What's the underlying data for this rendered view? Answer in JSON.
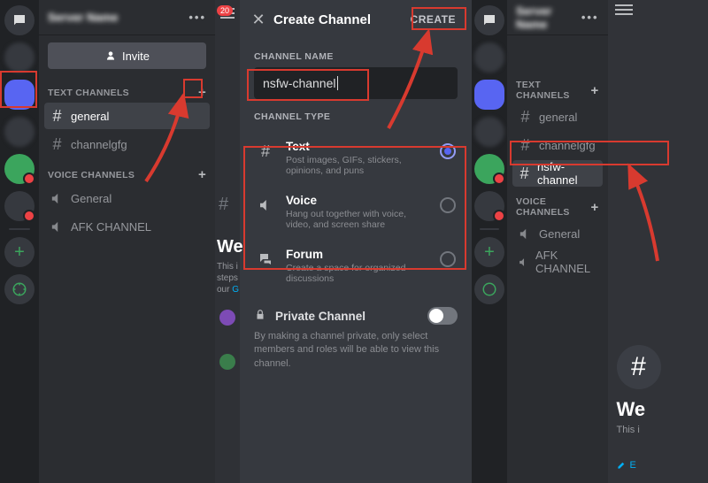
{
  "left": {
    "server_name_blur": "Server Name",
    "invite_label": "Invite",
    "cat_text": "TEXT CHANNELS",
    "cat_voice": "VOICE CHANNELS",
    "channels_text": [
      {
        "name": "general",
        "active": true
      },
      {
        "name": "channelgfg",
        "active": false
      }
    ],
    "channels_voice": [
      {
        "name": "General"
      },
      {
        "name": "AFK CHANNEL"
      }
    ]
  },
  "modal": {
    "title": "Create Channel",
    "create_label": "CREATE",
    "name_section": "CHANNEL NAME",
    "name_value": "nsfw-channel",
    "type_section": "CHANNEL TYPE",
    "types": [
      {
        "title": "Text",
        "desc": "Post images, GIFs, stickers, opinions, and puns",
        "selected": true
      },
      {
        "title": "Voice",
        "desc": "Hang out together with voice, video, and screen share",
        "selected": false
      },
      {
        "title": "Forum",
        "desc": "Create a space for organized discussions",
        "selected": false
      }
    ],
    "private_label": "Private Channel",
    "private_desc": "By making a channel private, only select members and roles will be able to view this channel.",
    "badge": "20"
  },
  "right": {
    "server_name_blur": "Server Name",
    "cat_text": "TEXT CHANNELS",
    "cat_voice": "VOICE CHANNELS",
    "channels_text": [
      {
        "name": "general",
        "active": false
      },
      {
        "name": "channelgfg",
        "active": false
      },
      {
        "name": "nsfw-channel",
        "active": true
      }
    ],
    "channels_voice": [
      {
        "name": "General"
      },
      {
        "name": "AFK CHANNEL"
      }
    ],
    "welcome": "We",
    "welcome_sub": "This i",
    "edit": "E"
  }
}
